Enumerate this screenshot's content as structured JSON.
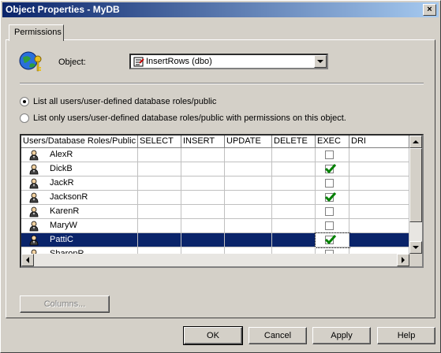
{
  "window": {
    "title": "Object Properties - MyDB"
  },
  "tabs": [
    {
      "label": "Permissions"
    }
  ],
  "object": {
    "label": "Object:",
    "selected": "InsertRows (dbo)"
  },
  "options": {
    "list_all": "List all users/user-defined database roles/public",
    "list_only": "List only users/user-defined database roles/public with permissions on this object.",
    "selected": "list_all"
  },
  "grid": {
    "columns": [
      "Users/Database Roles/Public",
      "SELECT",
      "INSERT",
      "UPDATE",
      "DELETE",
      "EXEC",
      "DRI"
    ],
    "rows": [
      {
        "name": "AlexR",
        "exec": false
      },
      {
        "name": "DickB",
        "exec": true
      },
      {
        "name": "JackR",
        "exec": false
      },
      {
        "name": "JacksonR",
        "exec": true
      },
      {
        "name": "KarenR",
        "exec": false
      },
      {
        "name": "MaryW",
        "exec": false
      },
      {
        "name": "PattiC",
        "exec": true,
        "selected": true
      },
      {
        "name": "SharonR",
        "exec": false
      }
    ]
  },
  "buttons": {
    "columns": "Columns...",
    "ok": "OK",
    "cancel": "Cancel",
    "apply": "Apply",
    "help": "Help"
  },
  "colors": {
    "title_start": "#0a246a",
    "title_end": "#a6caf0",
    "selection": "#0a246a",
    "check": "#008000"
  }
}
